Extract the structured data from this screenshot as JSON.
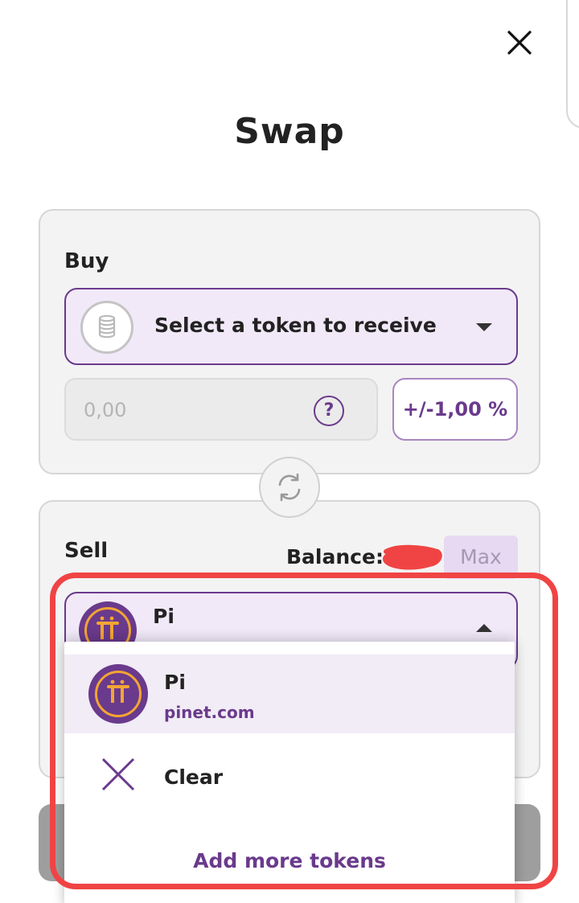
{
  "header": {
    "title": "Swap",
    "close_icon": "close-icon"
  },
  "buy": {
    "label": "Buy",
    "token_select": {
      "text": "Select a token to receive",
      "icon": "coins-icon"
    },
    "amount": {
      "value": "0,00"
    },
    "help_glyph": "?",
    "slippage_label": "+/-1,00 %"
  },
  "swap_toggle": {
    "icon": "refresh-icon"
  },
  "sell": {
    "label": "Sell",
    "balance_label": "Balance:",
    "max_label": "Max",
    "selected_token": {
      "name": "Pi",
      "icon": "pi-logo-icon"
    }
  },
  "dropdown": {
    "items": [
      {
        "name": "Pi",
        "subtitle": "pinet.com",
        "icon": "pi-logo-icon"
      },
      {
        "name": "Clear",
        "icon": "clear-icon"
      }
    ],
    "add_more_label": "Add more tokens"
  },
  "colors": {
    "accent": "#6a3a8c",
    "accent_light": "#f1e9f8",
    "pi_gold": "#f3a533",
    "annotation_red": "#f04444",
    "card_bg": "#f3f3f3"
  }
}
